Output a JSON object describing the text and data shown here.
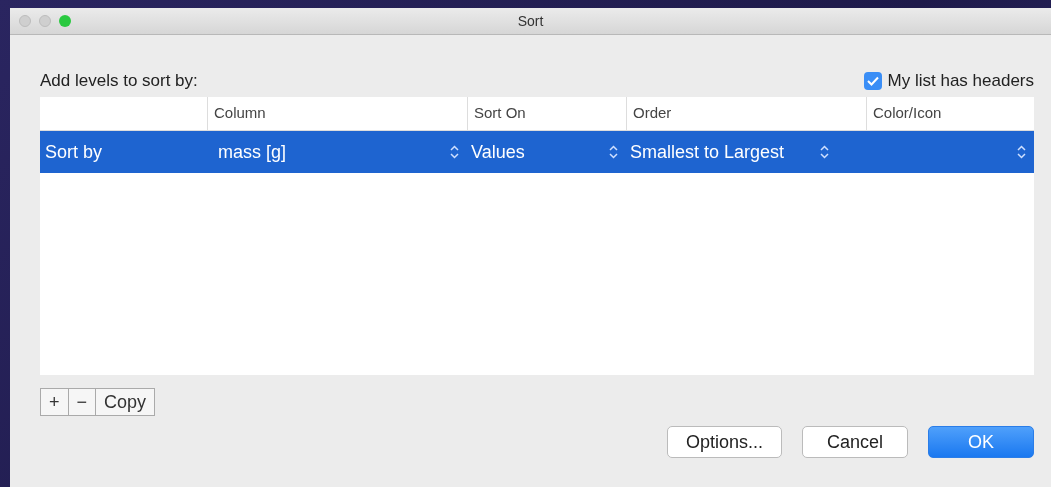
{
  "window": {
    "title": "Sort"
  },
  "prompt": "Add levels to sort by:",
  "headers_checkbox": {
    "label": "My list has headers",
    "checked": true
  },
  "table": {
    "columns": [
      "Column",
      "Sort On",
      "Order",
      "Color/Icon"
    ],
    "rows": [
      {
        "label": "Sort by",
        "column": "mass [g]",
        "sort_on": "Values",
        "order": "Smallest to Largest",
        "selected": true
      }
    ]
  },
  "level_buttons": [
    "+",
    "−",
    "Copy"
  ],
  "buttons": [
    {
      "label": "Options...",
      "kind": "normal"
    },
    {
      "label": "Cancel",
      "kind": "normal"
    },
    {
      "label": "OK",
      "kind": "default"
    }
  ]
}
